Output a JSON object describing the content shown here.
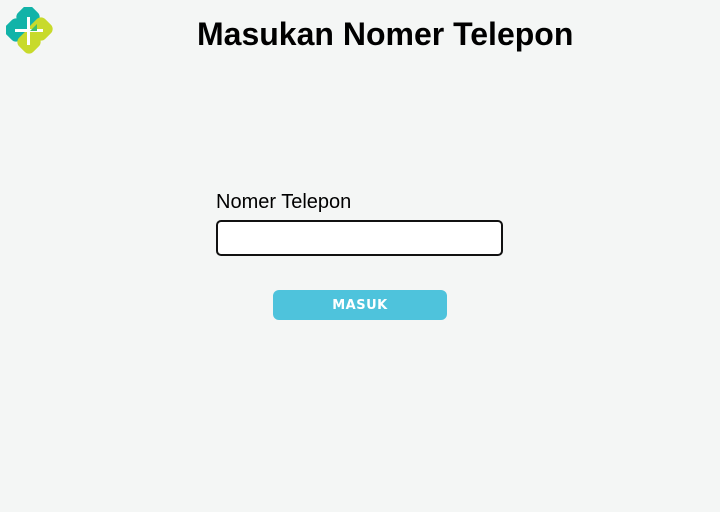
{
  "header": {
    "logo_icon": "kemenkes-flower-logo",
    "title": "Masukan Nomer Telepon"
  },
  "form": {
    "phone_label": "Nomer Telepon",
    "phone_value": "",
    "submit_label": "MASUK"
  },
  "colors": {
    "background": "#f4f6f5",
    "button": "#4ec3dc",
    "logo_teal": "#12b3a8",
    "logo_lime": "#c8da2b",
    "logo_green": "#3fbf6a"
  }
}
